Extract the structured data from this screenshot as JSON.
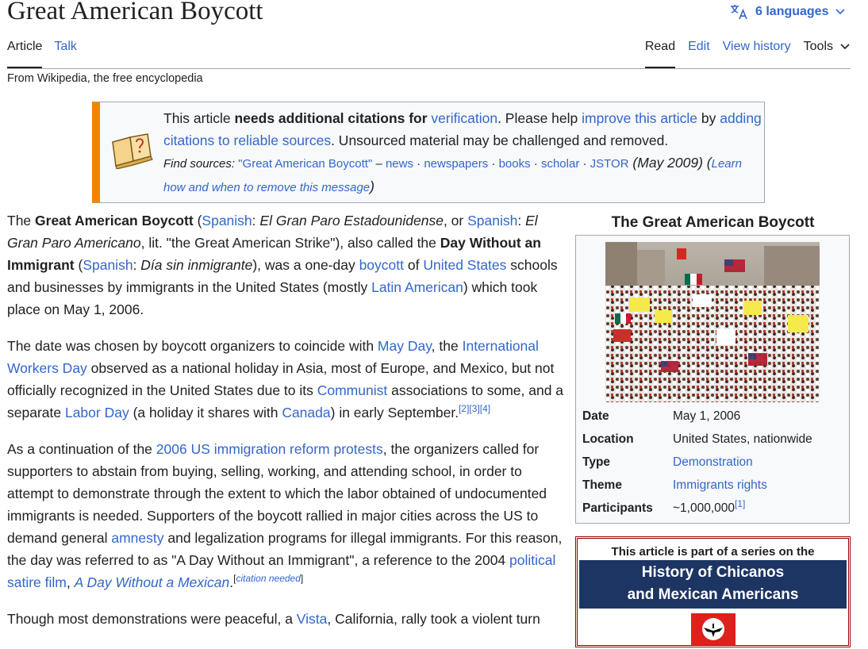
{
  "page": {
    "title": "Great American Boycott",
    "tagline": "From Wikipedia, the free encyclopedia"
  },
  "header": {
    "languages_label": "6 languages",
    "tabs_left": [
      "Article",
      "Talk"
    ],
    "tabs_right": [
      "Read",
      "Edit",
      "View history",
      "Tools"
    ]
  },
  "ambox": {
    "t1": "This article ",
    "t2": "needs additional citations for ",
    "t3": "verification",
    "t4": ". Please help ",
    "t5": "improve this article",
    "t6": " by ",
    "t7": "adding citations to reliable sources",
    "t8": ". Unsourced material may be challenged and removed.",
    "find_label": "Find sources:",
    "find_query": "\"Great American Boycott\"",
    "dash": " – ",
    "src_news": "news",
    "src_newspapers": "newspapers",
    "src_books": "books",
    "src_scholar": "scholar",
    "src_jstor": "JSTOR",
    "sep": " · ",
    "date": " (May 2009) (",
    "learn": "Learn how and when to remove this message",
    "close_paren": ")"
  },
  "p1": {
    "a": "The ",
    "b": "Great American Boycott",
    "c": " (",
    "d": "Spanish",
    "e": ": ",
    "f": "El Gran Paro Estadounidense",
    "g": ", or ",
    "h": "Spanish",
    "i": ": ",
    "j": "El Gran Paro Americano",
    "k": ", lit. \"the Great American Strike\"), also called the ",
    "l": "Day Without an Immigrant",
    "m": " (",
    "n": "Spanish",
    "o": ": ",
    "p": "Día sin inmigrante",
    "q": "), was a one-day ",
    "r": "boycott",
    "s": " of ",
    "t": "United States",
    "u": " schools and businesses by immigrants in the United States (mostly ",
    "v": "Latin American",
    "w": ") which took place on May 1, 2006."
  },
  "p2": {
    "a": "The date was chosen by boycott organizers to coincide with ",
    "b": "May Day",
    "c": ", the ",
    "d": "International Workers Day",
    "e": " observed as a national holiday in Asia, most of Europe, and Mexico, but not officially recognized in the United States due to its ",
    "f": "Communist",
    "g": " associations to some, and a separate ",
    "h": "Labor Day",
    "i": " (a holiday it shares with ",
    "j": "Canada",
    "k": ") in early September.",
    "refs": "[2][3][4]"
  },
  "p3": {
    "a": "As a continuation of the ",
    "b": "2006 US immigration reform protests",
    "c": ", the organizers called for supporters to abstain from buying, selling, working, and attending school, in order to attempt to demonstrate through the extent to which the labor obtained of undocumented immigrants is needed. Supporters of the boycott rallied in major cities across the US to demand general ",
    "d": "amnesty",
    "e": " and legalization programs for illegal immigrants. For this reason, the day was referred to as \"A Day Without an Immigrant\", a reference to the 2004 ",
    "f": "political satire film",
    "g": ", ",
    "h": "A Day Without a Mexican",
    "i": ".",
    "cn": "[citation needed]",
    "cn_open": "[",
    "cn_text": "citation needed",
    "cn_close": "]"
  },
  "p4": {
    "a": "Though most demonstrations were peaceful, a ",
    "b": "Vista",
    "c": ", California, rally took a violent turn"
  },
  "infobox": {
    "caption": "The Great American Boycott",
    "rows": [
      {
        "label": "Date",
        "value": "May 1, 2006"
      },
      {
        "label": "Location",
        "value": "United States, nationwide"
      },
      {
        "label": "Type",
        "value": "Demonstration"
      },
      {
        "label": "Theme",
        "value": "Immigrants rights"
      },
      {
        "label": "Participants",
        "value": "~1,000,000",
        "ref": "[1]"
      }
    ]
  },
  "series": {
    "pre": "This article is part of a series on the",
    "head1": "History of Chicanos",
    "head2": "and Mexican Americans"
  },
  "colors": {
    "link": "#3366cc",
    "visited": "#795cb2",
    "ambox_stripe": "#f28500",
    "series_head": "#1d3563",
    "series_border": "#9a0000"
  }
}
